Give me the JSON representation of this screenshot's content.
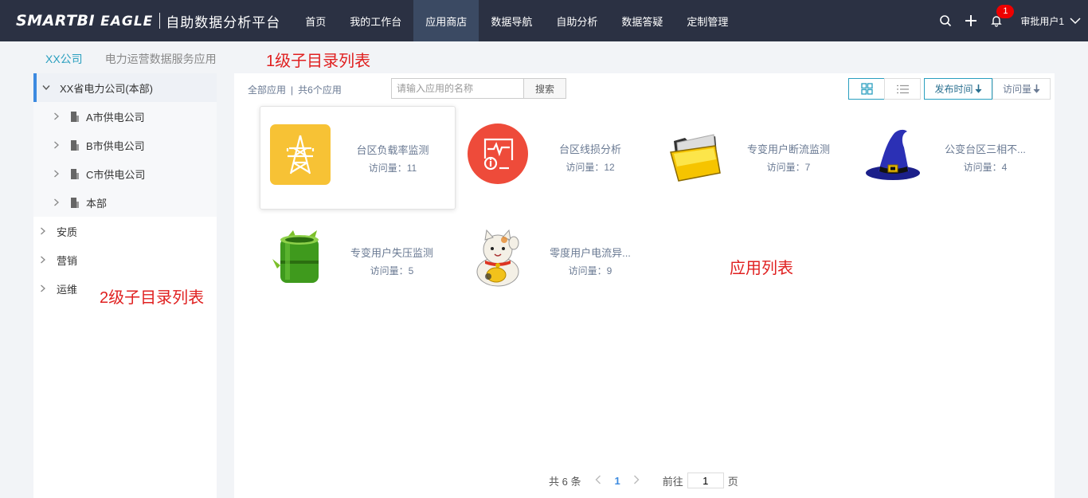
{
  "header": {
    "logo_text": "SMARTBI",
    "logo_sub": "EAGLE",
    "platform_title": "自助数据分析平台",
    "nav": [
      {
        "label": "首页",
        "active": false
      },
      {
        "label": "我的工作台",
        "active": false
      },
      {
        "label": "应用商店",
        "active": true
      },
      {
        "label": "数据导航",
        "active": false
      },
      {
        "label": "自助分析",
        "active": false
      },
      {
        "label": "数据答疑",
        "active": false
      },
      {
        "label": "定制管理",
        "active": false
      }
    ],
    "notification_count": "1",
    "user_name": "审批用户1"
  },
  "level1": {
    "items": [
      "XX公司",
      "电力运营数据服务应用"
    ],
    "annotation": "1级子目录列表"
  },
  "sidebar": {
    "root": "XX省电力公司(本部)",
    "children": [
      "A市供电公司",
      "B市供电公司",
      "C市供电公司",
      "本部"
    ],
    "others": [
      "安质",
      "营销",
      "运维"
    ],
    "annotation": "2级子目录列表"
  },
  "toolbar": {
    "all_apps": "全部应用",
    "count_text": "共6个应用",
    "search_placeholder": "请输入应用的名称",
    "search_button": "搜索",
    "sort_publish": "发布时间",
    "sort_visits": "访问量"
  },
  "apps": [
    {
      "name": "台区负载率监测",
      "visits": "访问量：11",
      "icon": "power-tower-icon"
    },
    {
      "name": "台区线损分析",
      "visits": "访问量：12",
      "icon": "monitor-info-icon"
    },
    {
      "name": "专变用户断流监测",
      "visits": "访问量：7",
      "icon": "folder-icon"
    },
    {
      "name": "公变台区三相不...",
      "visits": "访问量：4",
      "icon": "wizard-hat-icon"
    },
    {
      "name": "专变用户失压监测",
      "visits": "访问量：5",
      "icon": "bamboo-icon"
    },
    {
      "name": "零度用户电流异...",
      "visits": "访问量：9",
      "icon": "lucky-cat-icon"
    }
  ],
  "main_annotation": "应用列表",
  "pager": {
    "total": "共 6 条",
    "current": "1",
    "goto_prefix": "前往",
    "goto_value": "1",
    "goto_suffix": "页"
  },
  "colors": {
    "topbar": "#2b3143",
    "active_nav": "#3b4a63",
    "accent": "#2a9fbf",
    "annotation": "#e02020"
  }
}
